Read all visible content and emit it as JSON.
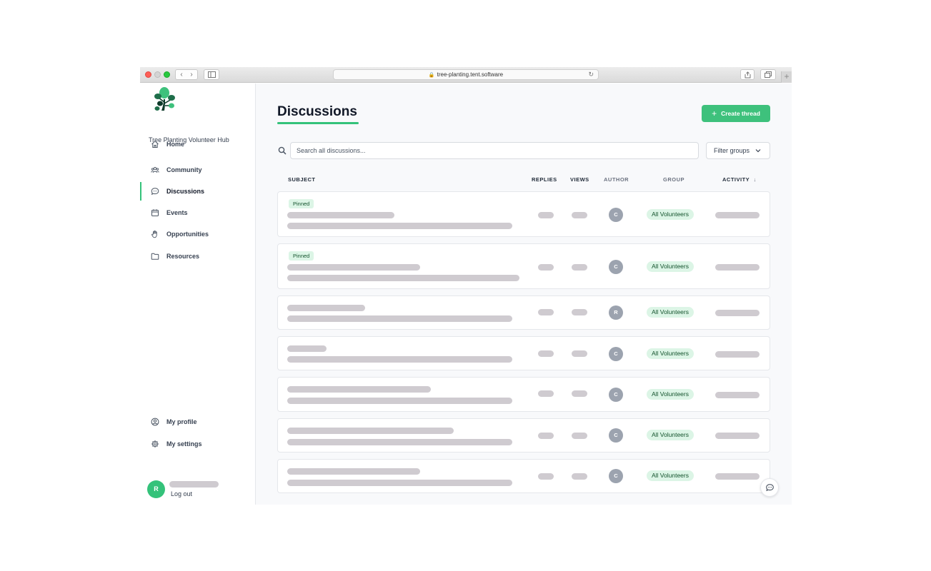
{
  "browser": {
    "url": "tree-planting.tent.software",
    "new_tab": "+",
    "back": "‹",
    "forward": "›"
  },
  "app": {
    "name": "Tree Planting Volunteer Hub",
    "logo_icon": "tree-icon",
    "brand_color": "#3ec17c"
  },
  "sidebar": {
    "items": [
      {
        "label": "Home",
        "icon": "home-icon"
      },
      {
        "label": "Community",
        "icon": "people-icon"
      },
      {
        "label": "Discussions",
        "icon": "chat-icon",
        "active": true
      },
      {
        "label": "Events",
        "icon": "calendar-icon"
      },
      {
        "label": "Opportunities",
        "icon": "hand-icon"
      },
      {
        "label": "Resources",
        "icon": "folder-icon"
      }
    ],
    "bottom_items": [
      {
        "label": "My profile",
        "icon": "user-circle-icon"
      },
      {
        "label": "My settings",
        "icon": "gear-icon"
      }
    ],
    "user": {
      "initial": "R",
      "logout_label": "Log out"
    }
  },
  "main": {
    "title": "Discussions",
    "create_label": "Create thread",
    "search_placeholder": "Search all discussions...",
    "filter_label": "Filter groups",
    "columns": {
      "subject": "SUBJECT",
      "replies": "REPLIES",
      "views": "VIEWS",
      "author": "AUTHOR",
      "group": "GROUP",
      "activity": "ACTIVITY",
      "sort_indicator": "↓"
    },
    "pinned_label": "Pinned",
    "threads": [
      {
        "pinned": true,
        "author": "C",
        "group": "All Volunteers"
      },
      {
        "pinned": true,
        "author": "C",
        "group": "All Volunteers"
      },
      {
        "pinned": false,
        "author": "R",
        "group": "All Volunteers"
      },
      {
        "pinned": false,
        "author": "C",
        "group": "All Volunteers"
      },
      {
        "pinned": false,
        "author": "C",
        "group": "All Volunteers"
      },
      {
        "pinned": false,
        "author": "C",
        "group": "All Volunteers"
      },
      {
        "pinned": false,
        "author": "C",
        "group": "All Volunteers"
      }
    ]
  }
}
